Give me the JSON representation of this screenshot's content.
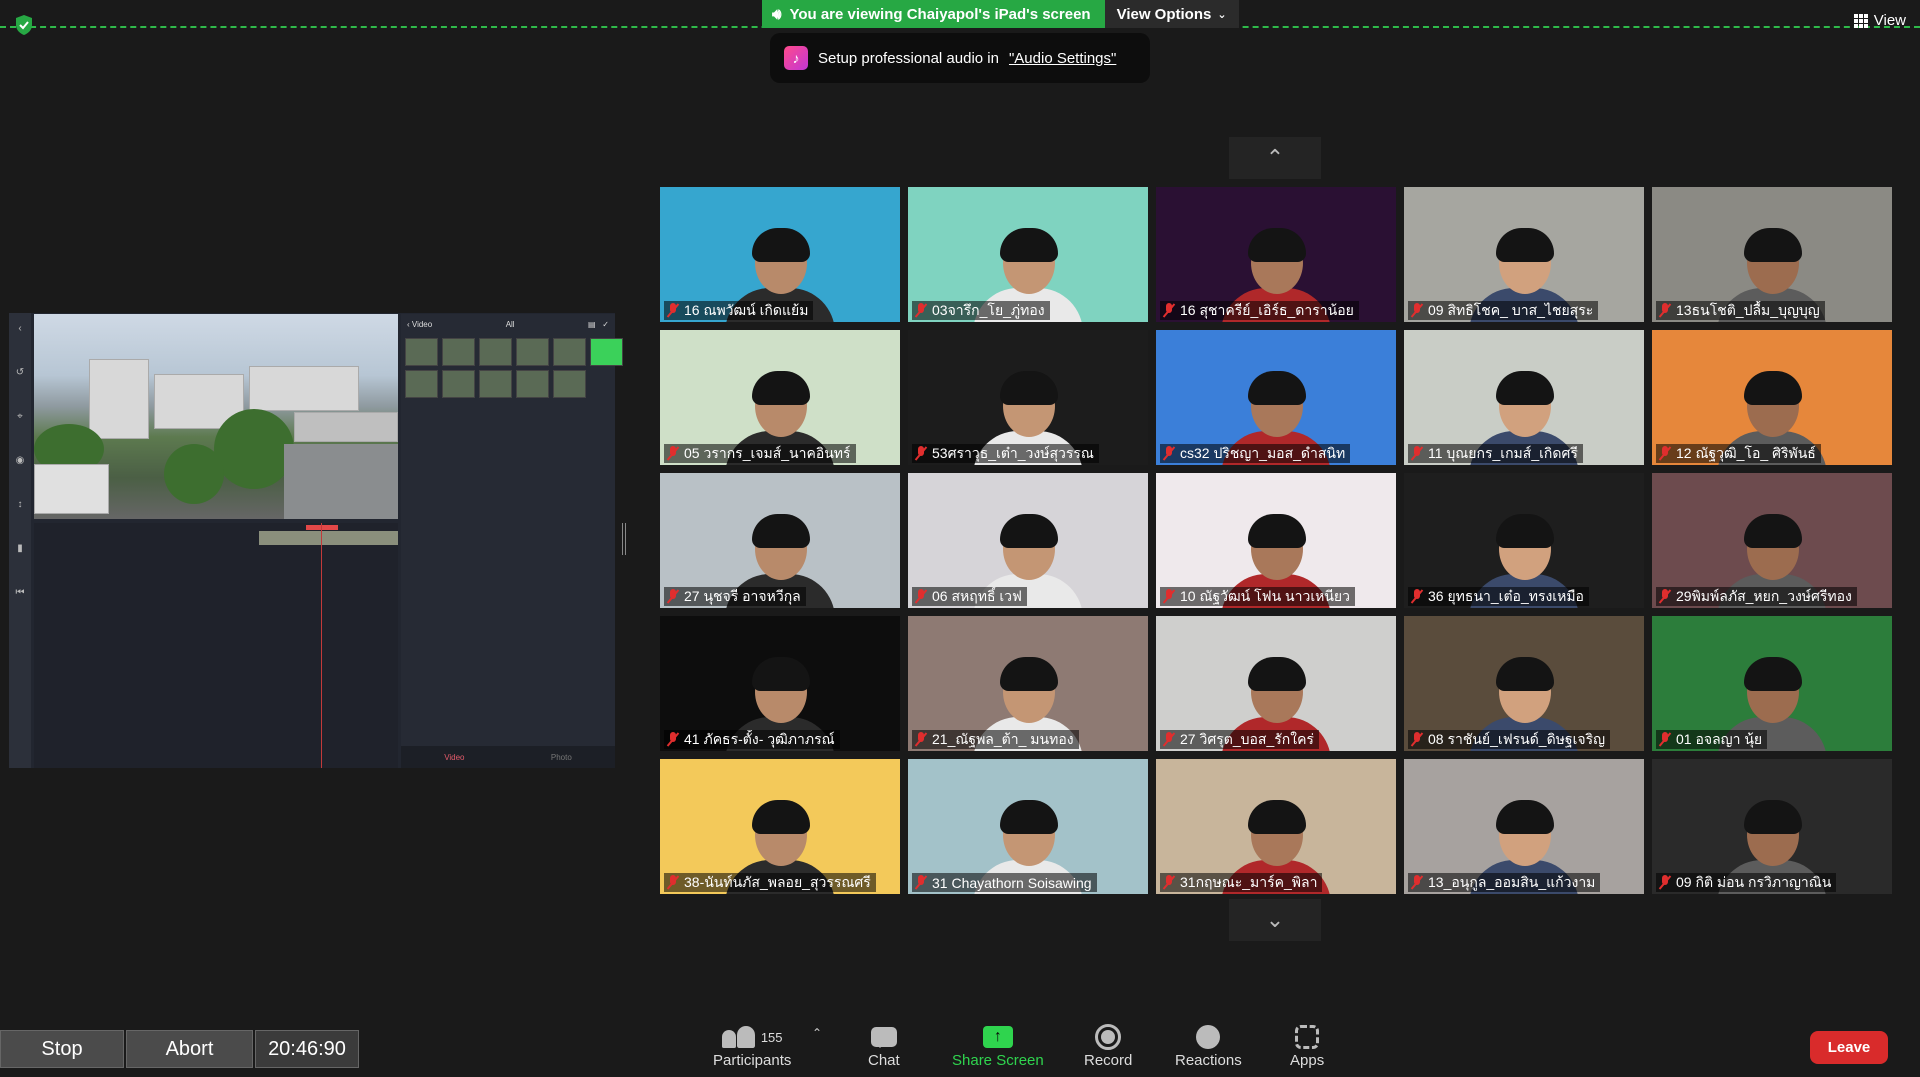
{
  "banner": {
    "viewing_text": "You are viewing Chaiyapol's iPad's screen",
    "view_options_label": "View Options"
  },
  "audio_tip": {
    "prefix": "Setup professional audio in",
    "link": "\"Audio Settings\""
  },
  "top_right": {
    "view_label": "View"
  },
  "share_panel": {
    "media_back": "Video",
    "media_filter": "All",
    "tab_video": "Video",
    "tab_photo": "Photo"
  },
  "participants": [
    {
      "name": "16 ณพวัฒน์ เกิดแย้ม",
      "bg": "#36a6cf"
    },
    {
      "name": "03จารึก_โย_ภู่ทอง",
      "bg": "#7fd3c0"
    },
    {
      "name": "16 สุชาครีย์_เอิร์ธ_ดาราน้อย",
      "bg": "#2a1033"
    },
    {
      "name": "09 สิทธิโชค_ บาส_ไชยสุระ",
      "bg": "#a6a6a0"
    },
    {
      "name": "13ธนโชติ_ปลื้ม_บุญบุญ",
      "bg": "#8b8a84"
    },
    {
      "name": "05 วรากร_เจมส์_นาคอินทร์",
      "bg": "#cfe0c8"
    },
    {
      "name": "53ศราวุธ_เต๋า_วงษ์สุวรรณ",
      "bg": "#1c1c1c"
    },
    {
      "name": "cs32 ปริชญา_มอส_ดำสนิท",
      "bg": "#3b7fd9"
    },
    {
      "name": "11 บุณยกร_เกมส์_เกิดศรี",
      "bg": "#c9cdc6"
    },
    {
      "name": "12 ณัฐวุฒิ_โอ_ ศิริพันธ์",
      "bg": "#e6873b"
    },
    {
      "name": "27 นุชจรี อาจหวีกุล",
      "bg": "#b9c1c6"
    },
    {
      "name": "06 สหฤทธิ์ เวฟ",
      "bg": "#d6d4d8"
    },
    {
      "name": "10 ณัฐวัฒน์ โฟน นาวเหนียว",
      "bg": "#efe9ec"
    },
    {
      "name": "36 ยุทธนา_เต๋อ_ทรงเหมือ",
      "bg": "#1e1e1e"
    },
    {
      "name": "29พิมพ์ลภัส_หยก_วงษ์ศรีทอง",
      "bg": "#6d4b4e"
    },
    {
      "name": "41 ภัคธร-ตั้ง- วุฒิภาภรณ์",
      "bg": "#0d0d0d"
    },
    {
      "name": "21_ณัฐพล_ต้า_ มนทอง",
      "bg": "#8e7a73"
    },
    {
      "name": "27 วิศรุต_บอส_รักใคร่",
      "bg": "#cfcfcd"
    },
    {
      "name": "08 ราชันย์_เฟรนด์_ดิษฐเจริญ",
      "bg": "#5a4c3c"
    },
    {
      "name": "01 อจลญา นุ้ย",
      "bg": "#2c7d3b"
    },
    {
      "name": "38-นันท์นภัส_พลอย_สุวรรณศรี",
      "bg": "#f3c95a"
    },
    {
      "name": "31 Chayathorn Soisawing",
      "bg": "#a3c2c9"
    },
    {
      "name": "31กฤษณะ_มาร์ค_พิลา",
      "bg": "#c8b59b"
    },
    {
      "name": "13_อนุกูล_ออมสิน_แก้วงาม",
      "bg": "#a7a29f"
    },
    {
      "name": "09 กิติ ม่อน กรวิภาญาณิน",
      "bg": "#2a2a2a"
    }
  ],
  "record": {
    "stop_label": "Stop",
    "abort_label": "Abort",
    "elapsed": "20:46:90"
  },
  "toolbar": {
    "participant_count": "155",
    "participants_label": "Participants",
    "chat_label": "Chat",
    "share_label": "Share Screen",
    "record_label": "Record",
    "reactions_label": "Reactions",
    "apps_label": "Apps",
    "leave_label": "Leave"
  },
  "colors": {
    "accent_green": "#2fd44e",
    "leave_red": "#d92b2b",
    "mic_off_red": "#e02e2e"
  }
}
